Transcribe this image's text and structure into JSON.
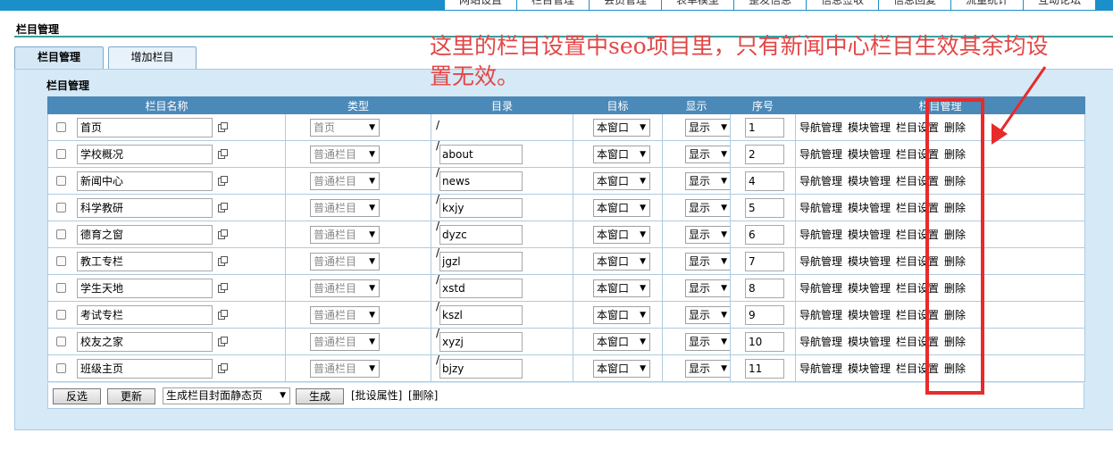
{
  "topnav": [
    "网站设置",
    "栏目管理",
    "会员管理",
    "表单模型",
    "整发信息",
    "信息签收",
    "信息回复",
    "流量统计",
    "互动论坛"
  ],
  "page_title": "栏目管理",
  "tabs": [
    {
      "label": "栏目管理",
      "active": true
    },
    {
      "label": "增加栏目",
      "active": false
    }
  ],
  "panel_title": "栏目管理",
  "columns": [
    "栏目名称",
    "类型",
    "目录",
    "目标",
    "显示",
    "序号",
    "栏目管理"
  ],
  "rows": [
    {
      "name": "首页",
      "type": "首页",
      "dir": "",
      "target": "本窗口",
      "show": "显示",
      "order": "1"
    },
    {
      "name": "学校概况",
      "type": "普通栏目",
      "dir": "about",
      "target": "本窗口",
      "show": "显示",
      "order": "2"
    },
    {
      "name": "新闻中心",
      "type": "普通栏目",
      "dir": "news",
      "target": "本窗口",
      "show": "显示",
      "order": "4"
    },
    {
      "name": "科学教研",
      "type": "普通栏目",
      "dir": "kxjy",
      "target": "本窗口",
      "show": "显示",
      "order": "5"
    },
    {
      "name": "德育之窗",
      "type": "普通栏目",
      "dir": "dyzc",
      "target": "本窗口",
      "show": "显示",
      "order": "6"
    },
    {
      "name": "教工专栏",
      "type": "普通栏目",
      "dir": "jgzl",
      "target": "本窗口",
      "show": "显示",
      "order": "7"
    },
    {
      "name": "学生天地",
      "type": "普通栏目",
      "dir": "xstd",
      "target": "本窗口",
      "show": "显示",
      "order": "8"
    },
    {
      "name": "考试专栏",
      "type": "普通栏目",
      "dir": "kszl",
      "target": "本窗口",
      "show": "显示",
      "order": "9"
    },
    {
      "name": "校友之家",
      "type": "普通栏目",
      "dir": "xyzj",
      "target": "本窗口",
      "show": "显示",
      "order": "10"
    },
    {
      "name": "班级主页",
      "type": "普通栏目",
      "dir": "bjzy",
      "target": "本窗口",
      "show": "显示",
      "order": "11"
    }
  ],
  "row_ops": [
    "导航管理",
    "模块管理",
    "栏目设置",
    "删除"
  ],
  "slash": "/",
  "bottom": {
    "invert_label": "反选",
    "update_label": "更新",
    "generate_select": "生成栏目封面静态页",
    "generate_label": "生成",
    "batch_text": "[批设属性]",
    "delete_text": "[删除]"
  },
  "annotation": "这里的栏目设置中seo项目里，只有新闻中心栏目生效其余均设置无效。",
  "colors": {
    "header": "#4b89b8",
    "panel": "#d6e9f6",
    "annotation": "#e34646",
    "topbar": "#1a8fc9"
  }
}
